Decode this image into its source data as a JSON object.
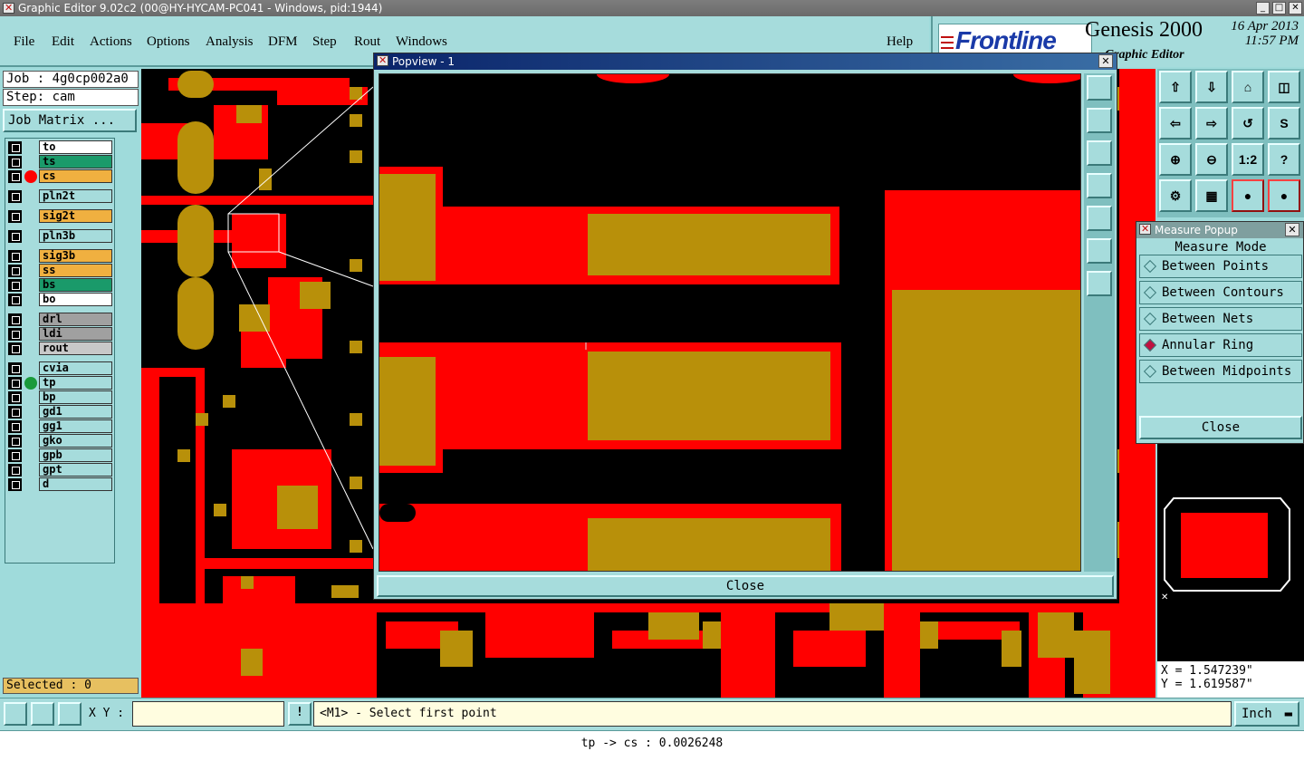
{
  "window": {
    "title": "Graphic Editor 9.02c2 (00@HY-HYCAM-PC041 - Windows, pid:1944)"
  },
  "menu": {
    "items": [
      "File",
      "Edit",
      "Actions",
      "Options",
      "Analysis",
      "DFM",
      "Step",
      "Rout",
      "Windows"
    ],
    "help": "Help"
  },
  "brand": {
    "logo": "Frontline",
    "product": "Genesis 2000",
    "date": "16 Apr 2013",
    "time": "11:57 PM",
    "subtitle": "Graphic Editor"
  },
  "job": {
    "label": "Job : 4g0cp002a0",
    "step": "Step: cam",
    "matrix_button": "Job Matrix ..."
  },
  "layers": [
    {
      "name": "to",
      "color": "#ffffff",
      "dot": ""
    },
    {
      "name": "ts",
      "color": "#1a9a6a",
      "dot": ""
    },
    {
      "name": "cs",
      "color": "#f0b040",
      "dot": "#ff0000"
    },
    {
      "name": "pln2t",
      "color": "#a6dcdc",
      "dot": ""
    },
    {
      "name": "sig2t",
      "color": "#f0b040",
      "dot": ""
    },
    {
      "name": "pln3b",
      "color": "#a6dcdc",
      "dot": ""
    },
    {
      "name": "sig3b",
      "color": "#f0b040",
      "dot": ""
    },
    {
      "name": "ss",
      "color": "#f0b040",
      "dot": ""
    },
    {
      "name": "bs",
      "color": "#1a9a6a",
      "dot": ""
    },
    {
      "name": "bo",
      "color": "#ffffff",
      "dot": ""
    },
    {
      "name": "drl",
      "color": "#a0a0a0",
      "dot": ""
    },
    {
      "name": "ldi",
      "color": "#a0a0a0",
      "dot": ""
    },
    {
      "name": "rout",
      "color": "#c8c8c8",
      "dot": ""
    },
    {
      "name": "cvia",
      "color": "#a6dcdc",
      "dot": ""
    },
    {
      "name": "tp",
      "color": "#a6dcdc",
      "dot": "#1a9a3a"
    },
    {
      "name": "bp",
      "color": "#a6dcdc",
      "dot": ""
    },
    {
      "name": "gd1",
      "color": "#a6dcdc",
      "dot": ""
    },
    {
      "name": "gg1",
      "color": "#a6dcdc",
      "dot": ""
    },
    {
      "name": "gko",
      "color": "#a6dcdc",
      "dot": ""
    },
    {
      "name": "gpb",
      "color": "#a6dcdc",
      "dot": ""
    },
    {
      "name": "gpt",
      "color": "#a6dcdc",
      "dot": ""
    },
    {
      "name": "d",
      "color": "#a6dcdc",
      "dot": ""
    }
  ],
  "selected": "Selected : 0",
  "popview": {
    "title": "Popview - 1",
    "close": "Close"
  },
  "measure": {
    "title": "Measure Popup",
    "mode_label": "Measure Mode",
    "options": [
      {
        "label": "Between Points",
        "selected": false
      },
      {
        "label": "Between Contours",
        "selected": false
      },
      {
        "label": "Between Nets",
        "selected": false
      },
      {
        "label": "Annular Ring",
        "selected": true
      },
      {
        "label": "Between Midpoints",
        "selected": false
      }
    ],
    "close": "Close"
  },
  "right_tools": [
    "1:2",
    "?"
  ],
  "coords": {
    "x": "X = 1.547239\"",
    "y": "Y = 1.619587\""
  },
  "bottom": {
    "xy_label": "X Y :",
    "xy_value": "",
    "prompt": "<M1> - Select first point",
    "units": "Inch"
  },
  "status": "tp -> cs : 0.0026248",
  "colors": {
    "copper": "#ff0000",
    "pad": "#b8900a",
    "background": "#000000",
    "panel": "#a6dcdc"
  }
}
